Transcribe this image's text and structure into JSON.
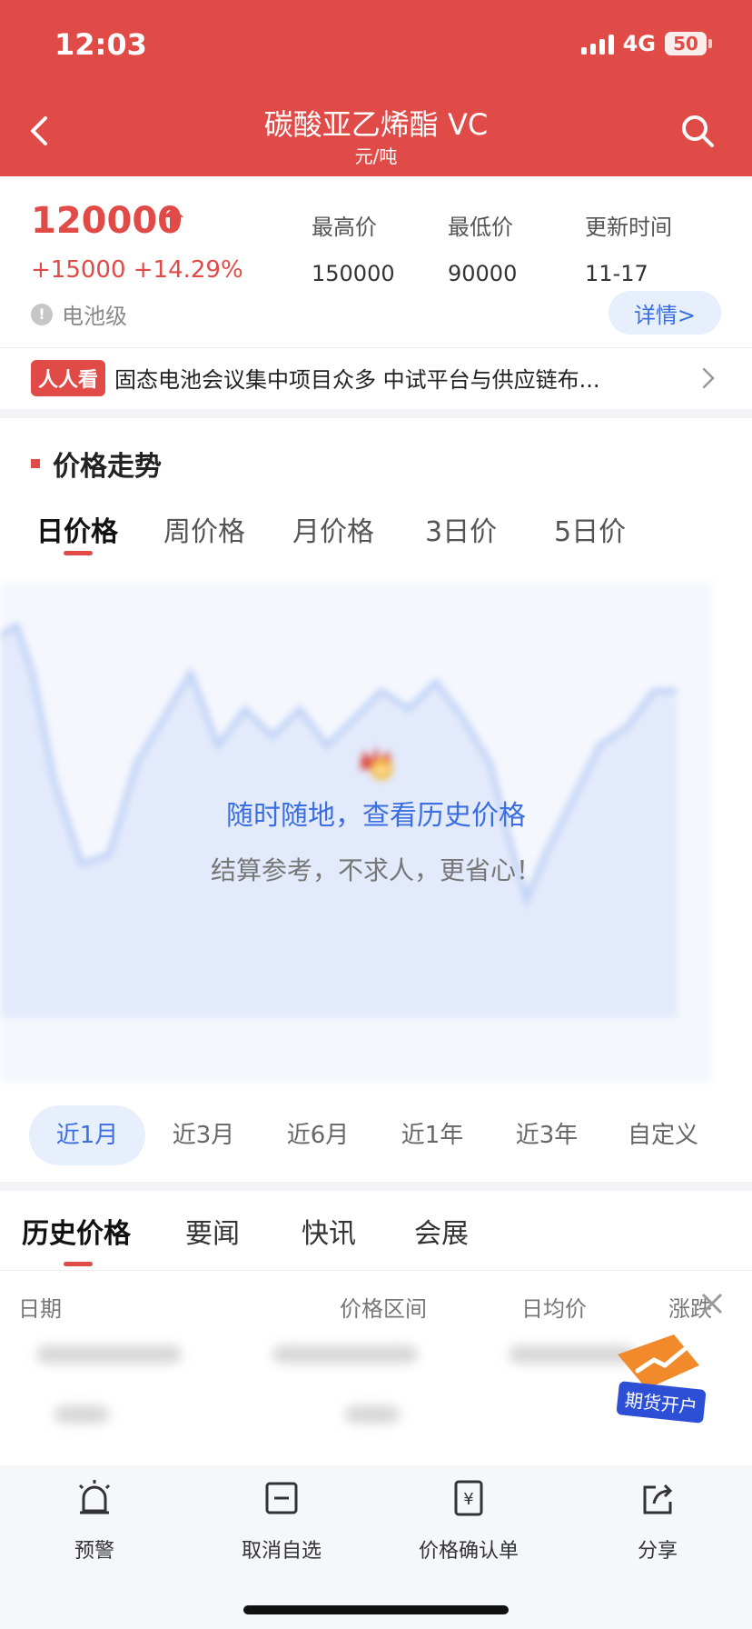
{
  "status_bar": {
    "time": "12:03",
    "network": "4G",
    "battery": "50"
  },
  "header": {
    "title": "碳酸亚乙烯酯 VC",
    "unit": "元/吨"
  },
  "quote": {
    "price": "120000",
    "change": "+15000 +14.29%",
    "grade": "电池级",
    "stats": [
      {
        "label": "最高价",
        "value": "150000"
      },
      {
        "label": "最低价",
        "value": "90000"
      },
      {
        "label": "更新时间",
        "value": "11-17"
      }
    ],
    "detail_button": "详情>"
  },
  "news_ticker": {
    "badge": "人人看",
    "text": "固态电池会议集中项目众多  中试平台与供应链布..."
  },
  "trend": {
    "title": "价格走势",
    "period_tabs": [
      "日价格",
      "周价格",
      "月价格",
      "3日价",
      "5日价"
    ],
    "overlay_title": "随时随地，查看历史价格",
    "overlay_subtitle": "结算参考，不求人，更省心！",
    "range_tabs": [
      "近1月",
      "近3月",
      "近6月",
      "近1年",
      "近3年",
      "自定义"
    ]
  },
  "content_tabs": [
    "历史价格",
    "要闻",
    "快讯",
    "会展"
  ],
  "table": {
    "headers": [
      "日期",
      "价格区间",
      "日均价",
      "涨跌"
    ]
  },
  "futures_badge": "期货开户",
  "bottom_bar": [
    {
      "label": "预警",
      "icon": "alarm-icon"
    },
    {
      "label": "取消自选",
      "icon": "minus-square-icon"
    },
    {
      "label": "价格确认单",
      "icon": "yuan-doc-icon"
    },
    {
      "label": "分享",
      "icon": "share-icon"
    }
  ],
  "colors": {
    "accent_red": "#e04a47",
    "link_blue": "#3b6ee0"
  }
}
